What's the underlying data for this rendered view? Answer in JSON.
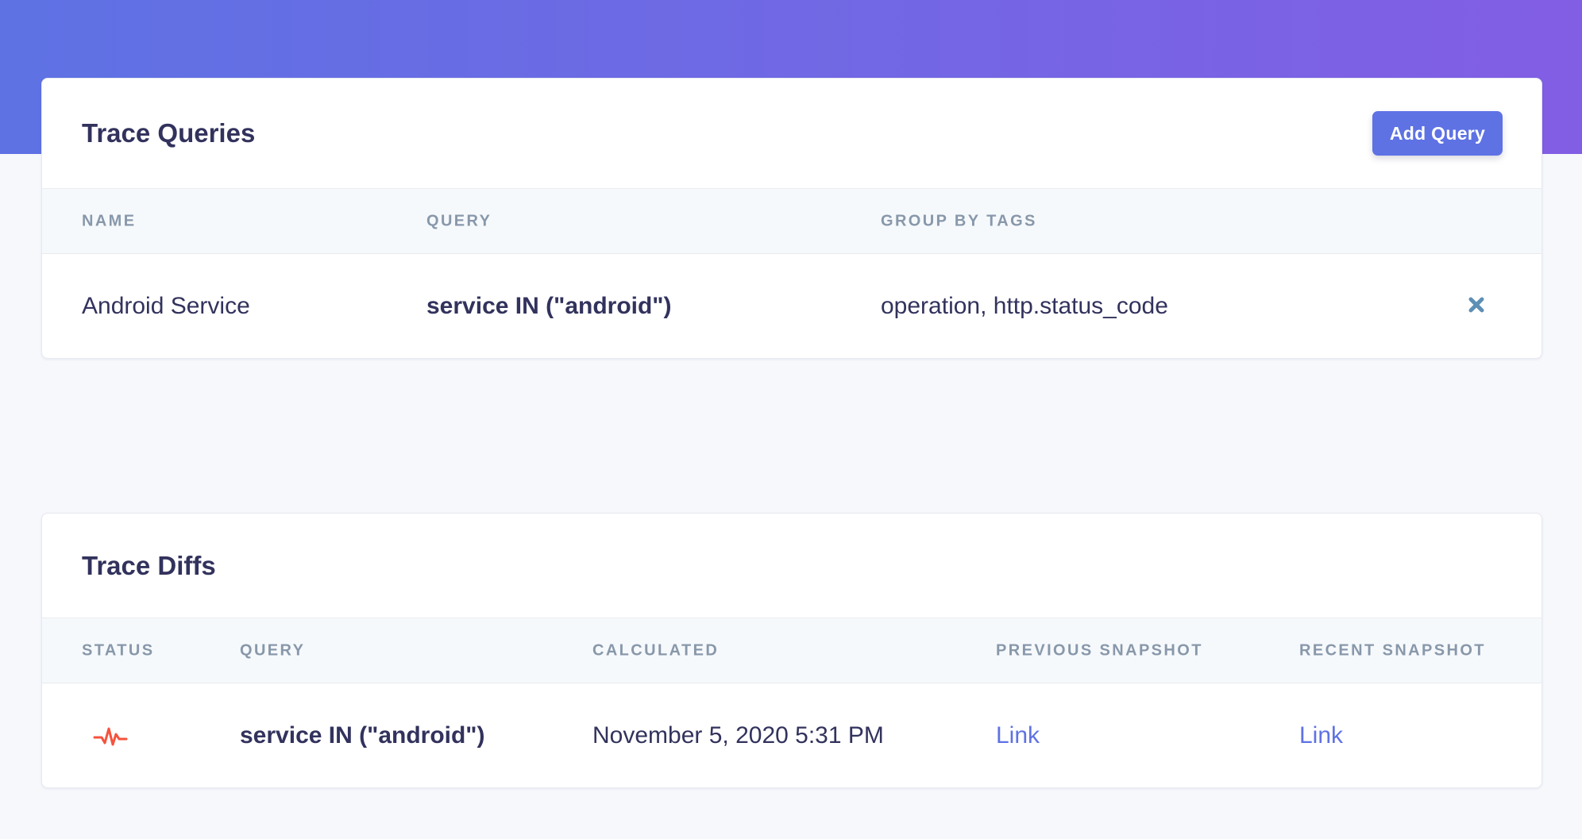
{
  "colors": {
    "header_gradient_start": "#5e72e4",
    "header_gradient_end": "#825ee4",
    "primary": "#5e72e4",
    "status_alert": "#f5533d",
    "delete_icon": "#5e8fb5"
  },
  "trace_queries": {
    "title": "Trace Queries",
    "add_button_label": "Add Query",
    "columns": [
      "NAME",
      "QUERY",
      "GROUP BY TAGS"
    ],
    "rows": [
      {
        "name": "Android Service",
        "query": "service IN (\"android\")",
        "group_by_tags": "operation, http.status_code",
        "delete_icon": "close-icon"
      }
    ]
  },
  "trace_diffs": {
    "title": "Trace Diffs",
    "columns": [
      "STATUS",
      "QUERY",
      "CALCULATED",
      "PREVIOUS SNAPSHOT",
      "RECENT SNAPSHOT"
    ],
    "rows": [
      {
        "status_icon": "pulse-icon",
        "query": "service IN (\"android\")",
        "calculated": "November 5, 2020 5:31 PM",
        "previous_snapshot": "Link",
        "recent_snapshot": "Link"
      }
    ]
  }
}
